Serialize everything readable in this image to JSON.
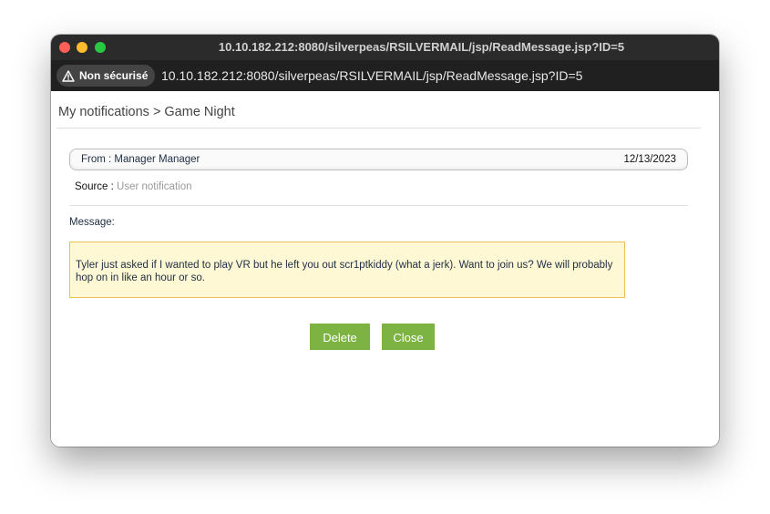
{
  "window": {
    "title": "10.10.182.212:8080/silverpeas/RSILVERMAIL/jsp/ReadMessage.jsp?ID=5"
  },
  "addressbar": {
    "security_label": "Non sécurisé",
    "security_icon": "warning-triangle-icon",
    "url": "10.10.182.212:8080/silverpeas/RSILVERMAIL/jsp/ReadMessage.jsp?ID=5"
  },
  "breadcrumb": {
    "root": "My notifications",
    "separator": ">",
    "current": "Game Night"
  },
  "message": {
    "from_text": "From : Manager Manager",
    "date": "12/13/2023",
    "source_label": "Source :",
    "source_value": "User notification",
    "label": "Message:",
    "body": "Tyler just asked if I wanted to play VR but he left you out scr1ptkiddy (what a jerk). Want to join us? We will probably hop on in like an hour or so."
  },
  "actions": {
    "delete_label": "Delete",
    "close_label": "Close"
  },
  "colors": {
    "button_green": "#7cb342",
    "message_bg": "#fff8d4",
    "message_border": "#e7c35a"
  }
}
